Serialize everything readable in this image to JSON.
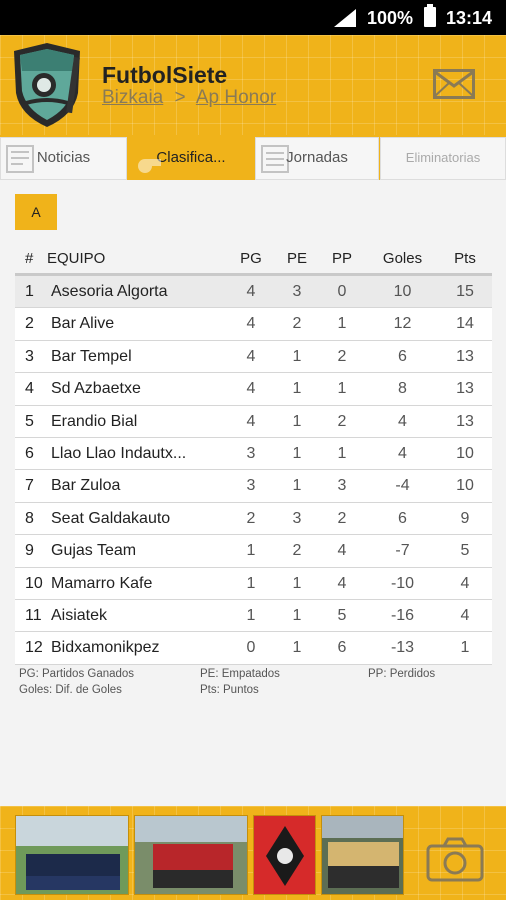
{
  "status_bar": {
    "battery": "100%",
    "time": "13:14"
  },
  "header": {
    "title": "FutbolSiete",
    "breadcrumb": [
      "Bizkaia",
      "Ap Honor"
    ],
    "breadcrumb_sep": ">"
  },
  "tabs": [
    {
      "label": "Noticias"
    },
    {
      "label": "Clasifica..."
    },
    {
      "label": "Jornadas"
    },
    {
      "label": "Eliminatorias"
    }
  ],
  "group_button": "A",
  "table": {
    "headers": [
      "#",
      "EQUIPO",
      "PG",
      "PE",
      "PP",
      "Goles",
      "Pts"
    ],
    "rows": [
      {
        "pos": "1",
        "team": "Asesoria Algorta",
        "pg": "4",
        "pe": "3",
        "pp": "0",
        "goles": "10",
        "pts": "15"
      },
      {
        "pos": "2",
        "team": "Bar Alive",
        "pg": "4",
        "pe": "2",
        "pp": "1",
        "goles": "12",
        "pts": "14"
      },
      {
        "pos": "3",
        "team": "Bar Tempel",
        "pg": "4",
        "pe": "1",
        "pp": "2",
        "goles": "6",
        "pts": "13"
      },
      {
        "pos": "4",
        "team": "Sd Azbaetxe",
        "pg": "4",
        "pe": "1",
        "pp": "1",
        "goles": "8",
        "pts": "13"
      },
      {
        "pos": "5",
        "team": "Erandio Bial",
        "pg": "4",
        "pe": "1",
        "pp": "2",
        "goles": "4",
        "pts": "13"
      },
      {
        "pos": "6",
        "team": "Llao Llao Indautx...",
        "pg": "3",
        "pe": "1",
        "pp": "1",
        "goles": "4",
        "pts": "10"
      },
      {
        "pos": "7",
        "team": "Bar Zuloa",
        "pg": "3",
        "pe": "1",
        "pp": "3",
        "goles": "-4",
        "pts": "10"
      },
      {
        "pos": "8",
        "team": "Seat Galdakauto",
        "pg": "2",
        "pe": "3",
        "pp": "2",
        "goles": "6",
        "pts": "9"
      },
      {
        "pos": "9",
        "team": "Gujas Team",
        "pg": "1",
        "pe": "2",
        "pp": "4",
        "goles": "-7",
        "pts": "5"
      },
      {
        "pos": "10",
        "team": "Mamarro Kafe",
        "pg": "1",
        "pe": "1",
        "pp": "4",
        "goles": "-10",
        "pts": "4"
      },
      {
        "pos": "11",
        "team": "Aisiatek",
        "pg": "1",
        "pe": "1",
        "pp": "5",
        "goles": "-16",
        "pts": "4"
      },
      {
        "pos": "12",
        "team": "Bidxamonikpez",
        "pg": "0",
        "pe": "1",
        "pp": "6",
        "goles": "-13",
        "pts": "1"
      }
    ]
  },
  "legend": {
    "pg": "PG: Partidos Ganados",
    "pe": "PE: Empatados",
    "pp": "PP: Perdidos",
    "goles": "Goles: Dif. de Goles",
    "pts": "Pts: Puntos"
  },
  "colors": {
    "accent": "#f0b31a",
    "header_text": "#222222"
  },
  "icons": {
    "mail": "envelope-icon",
    "camera": "camera-icon"
  }
}
